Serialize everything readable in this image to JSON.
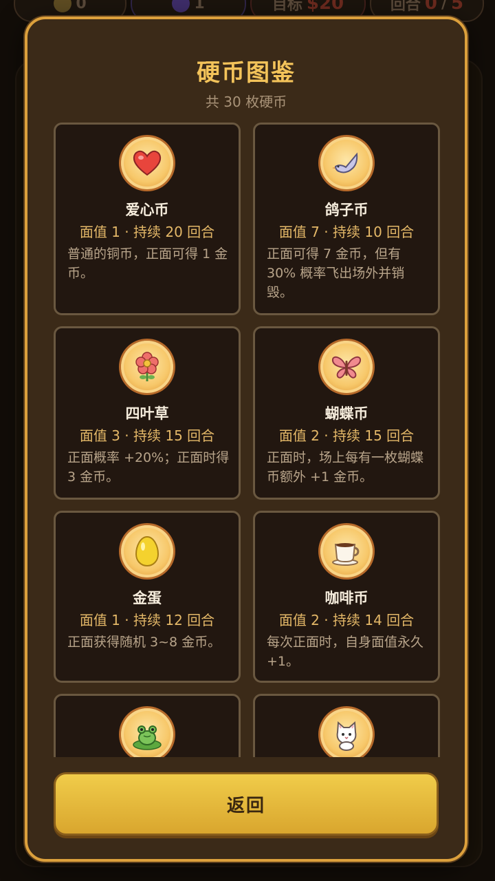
{
  "hud": {
    "coins": "0",
    "gems": "1",
    "target_label": "目标",
    "target_value": "$20",
    "round_label": "回合",
    "round_current": "0",
    "round_separator": "/",
    "round_total": "5"
  },
  "modal": {
    "title": "硬币图鉴",
    "subtitle": "共 30 枚硬币",
    "back_label": "返回"
  },
  "coins": [
    {
      "name": "爱心币",
      "stats": "面值 1 · 持续 20 回合",
      "desc": "普通的铜币，正面可得 1 金币。",
      "icon": "heart-icon"
    },
    {
      "name": "鸽子币",
      "stats": "面值 7 · 持续 10 回合",
      "desc": "正面可得 7 金币，但有 30% 概率飞出场外并销毁。",
      "icon": "dove-icon"
    },
    {
      "name": "四叶草",
      "stats": "面值 3 · 持续 15 回合",
      "desc": "正面概率 +20%；正面时得 3 金币。",
      "icon": "flower-icon"
    },
    {
      "name": "蝴蝶币",
      "stats": "面值 2 · 持续 15 回合",
      "desc": "正面时，场上每有一枚蝴蝶币额外 +1 金币。",
      "icon": "butterfly-icon"
    },
    {
      "name": "金蛋",
      "stats": "面值 1 · 持续 12 回合",
      "desc": "正面获得随机 3~8 金币。",
      "icon": "egg-icon"
    },
    {
      "name": "咖啡币",
      "stats": "面值 2 · 持续 14 回合",
      "desc": "每次正面时，自身面值永久 +1。",
      "icon": "coffee-icon"
    },
    {
      "name": "",
      "stats": "",
      "desc": "",
      "icon": "frog-icon"
    },
    {
      "name": "",
      "stats": "",
      "desc": "",
      "icon": "cat-icon"
    }
  ]
}
